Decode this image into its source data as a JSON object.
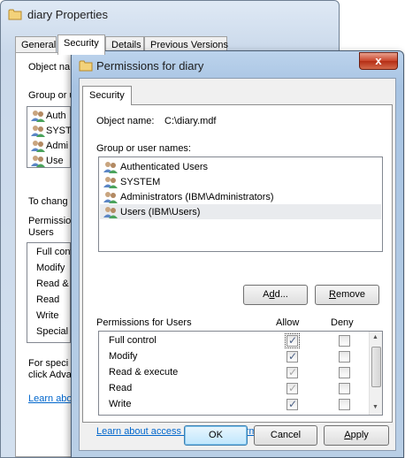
{
  "back_window": {
    "title": "diary Properties",
    "tabs": [
      "General",
      "Security",
      "Details",
      "Previous Versions"
    ],
    "object_name_label": "Object na",
    "group_label": "Group or u",
    "users": [
      "Auth",
      "SYST",
      "Admi",
      "Use"
    ],
    "change_text": "To chang",
    "permissions_label_1": "Permissio",
    "permissions_label_2": "Users",
    "permissions": [
      "Full contr",
      "Modify",
      "Read &",
      "Read",
      "Write",
      "Special"
    ],
    "special_text_1": "For speci",
    "special_text_2": "click Adva",
    "learn_link": "Learn abo"
  },
  "dialog": {
    "title": "Permissions for diary",
    "close_label": "x",
    "tab": "Security",
    "object_name_label": "Object name:",
    "object_name_value": "C:\\diary.mdf",
    "group_label": "Group or user names:",
    "users": [
      {
        "name": "Authenticated Users",
        "selected": false
      },
      {
        "name": "SYSTEM",
        "selected": false
      },
      {
        "name": "Administrators (IBM\\Administrators)",
        "selected": false
      },
      {
        "name": "Users (IBM\\Users)",
        "selected": true
      }
    ],
    "add_button_pre": "A",
    "add_button_u": "d",
    "add_button_post": "d...",
    "remove_button_u": "R",
    "remove_button_post": "emove",
    "permissions_for": "Permissions for Users",
    "allow_header": "Allow",
    "deny_header": "Deny",
    "permissions": [
      {
        "name": "Full control",
        "allow": true,
        "allow_disabled": false,
        "deny": false
      },
      {
        "name": "Modify",
        "allow": true,
        "allow_disabled": false,
        "deny": false
      },
      {
        "name": "Read & execute",
        "allow": true,
        "allow_disabled": true,
        "deny": false
      },
      {
        "name": "Read",
        "allow": true,
        "allow_disabled": true,
        "deny": false
      },
      {
        "name": "Write",
        "allow": true,
        "allow_disabled": false,
        "deny": false
      },
      {
        "name": "",
        "allow": false,
        "allow_disabled": false,
        "deny": false
      }
    ],
    "learn_link": "Learn about access control and permissions",
    "ok_button": "OK",
    "cancel_button": "Cancel",
    "apply_button_u": "A",
    "apply_button_post": "pply"
  }
}
